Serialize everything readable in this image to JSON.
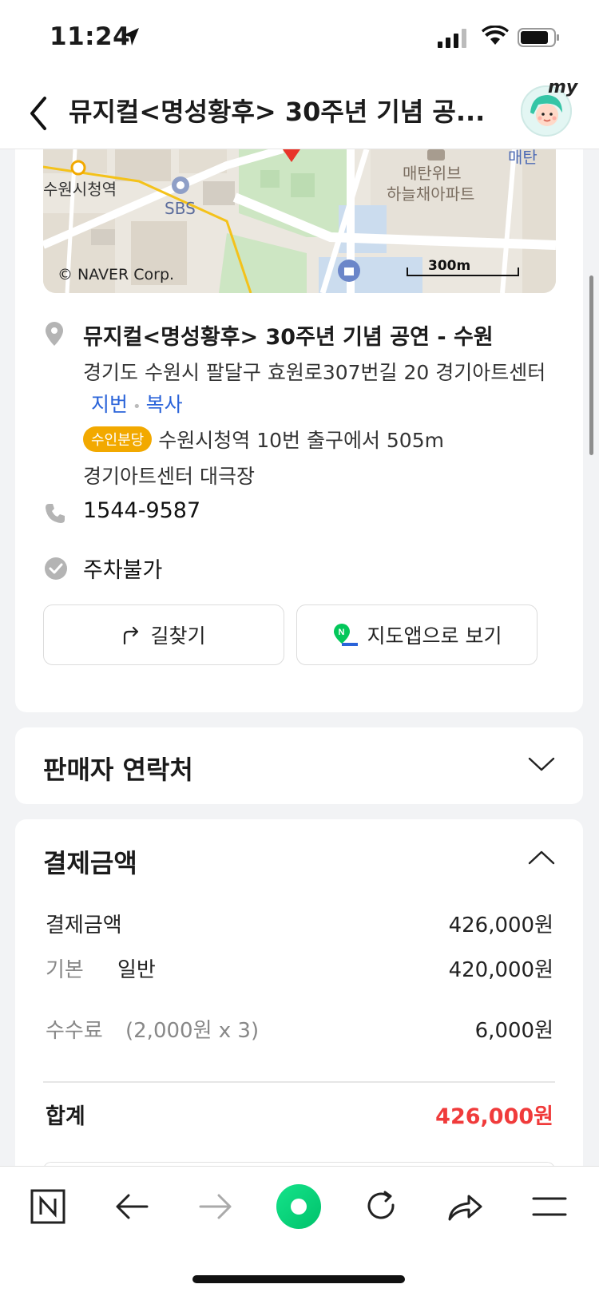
{
  "status_bar": {
    "time": "11:24"
  },
  "header": {
    "title": "뮤지컬<명성황후> 30주년 기념 공...",
    "avatar_badge": "my"
  },
  "map": {
    "labels": {
      "station": "수원시청역",
      "sbs": "SBS",
      "apt1": "매탄위브",
      "apt2": "하늘채아파트",
      "edge": "매탄"
    },
    "copyright": "© NAVER Corp.",
    "scale": "300m"
  },
  "place": {
    "name": "뮤지컬<명성황후> 30주년 기념 공연 - 수원",
    "address": "경기도 수원시 팔달구 효원로307번길 20 경기아트센터",
    "lot_link": "지번",
    "copy_link": "복사",
    "subway_badge": "수인분당",
    "subway_text": "수원시청역 10번 출구에서 505m",
    "hall": "경기아트센터 대극장",
    "phone": "1544-9587",
    "parking": "주차불가"
  },
  "buttons": {
    "directions": "길찾기",
    "map_app": "지도앱으로 보기"
  },
  "seller": {
    "title": "판매자 연락처"
  },
  "payment": {
    "title": "결제금액",
    "rows": [
      {
        "label": "결제금액",
        "sub": "",
        "value": "426,000원"
      },
      {
        "label": "기본",
        "sub": "일반",
        "value": "420,000원"
      },
      {
        "label": "수수료",
        "sub": "(2,000원 x 3)",
        "value": "6,000원"
      }
    ],
    "total_label": "합계",
    "total_value": "426,000원"
  },
  "colors": {
    "accent_red": "#f03b3b",
    "link_blue": "#2a63d9",
    "badge_orange": "#f2a900",
    "naver_green": "#03c75a"
  }
}
